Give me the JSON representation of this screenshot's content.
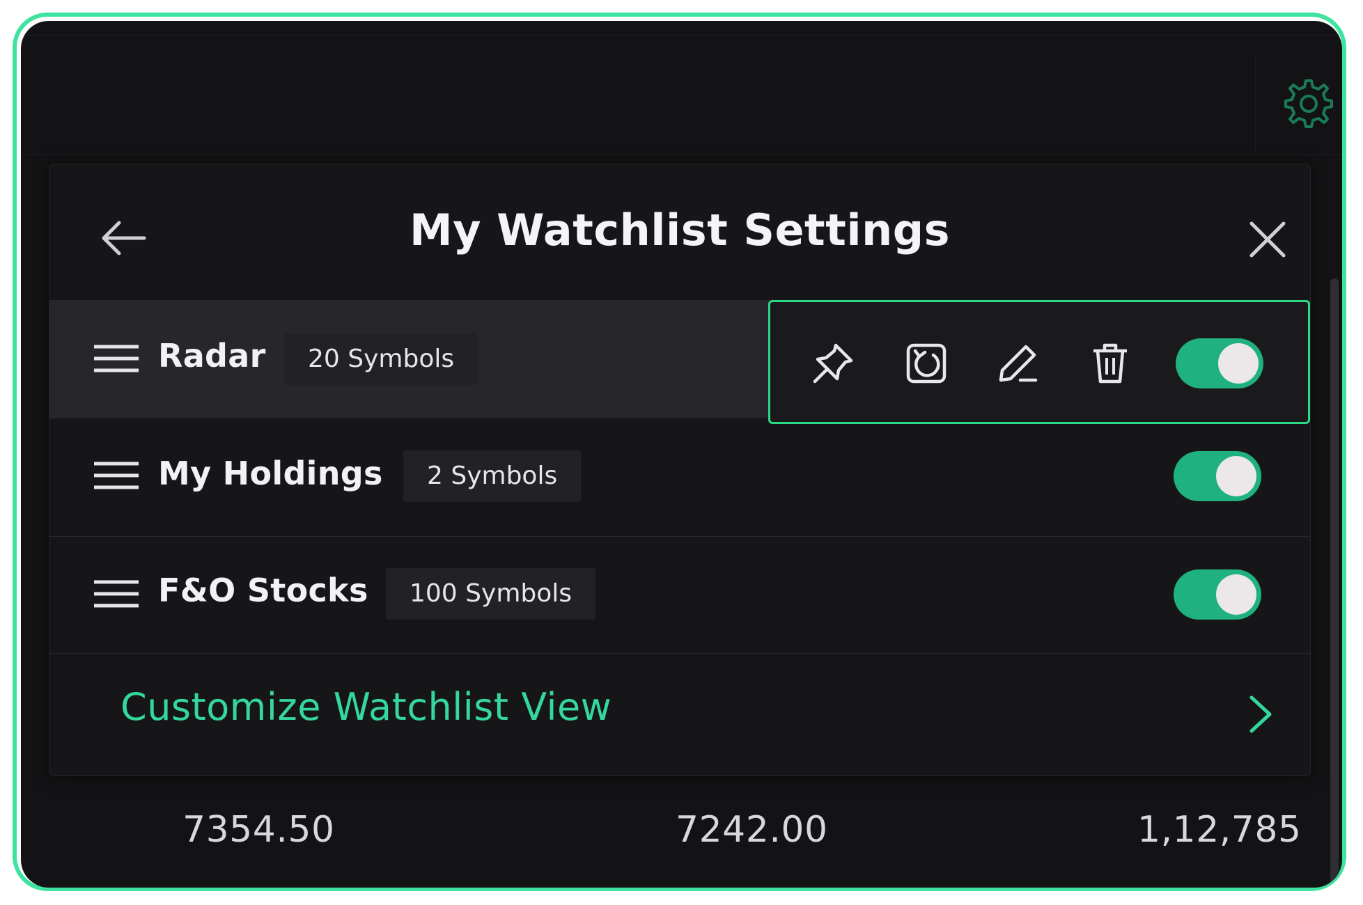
{
  "panel": {
    "title": "My Watchlist Settings",
    "watchlists": [
      {
        "name": "Radar",
        "symbols": "20 Symbols",
        "enabled": true
      },
      {
        "name": "My Holdings",
        "symbols": "2 Symbols",
        "enabled": true
      },
      {
        "name": "F&O Stocks",
        "symbols": "100 Symbols",
        "enabled": true
      }
    ],
    "customize_label": "Customize Watchlist View",
    "actions": [
      "pin-icon",
      "sync-icon",
      "edit-icon",
      "delete-icon"
    ]
  },
  "background_values": [
    "7354.50",
    "7242.00",
    "1,12,785"
  ],
  "colors": {
    "accent": "#35d89c",
    "toggle_on": "#1fb17f",
    "highlight_border": "#2bd985",
    "frame_border": "#3ee3a0",
    "screen_bg": "#131315",
    "panel_bg": "#161618",
    "active_row_bg": "#272729"
  }
}
